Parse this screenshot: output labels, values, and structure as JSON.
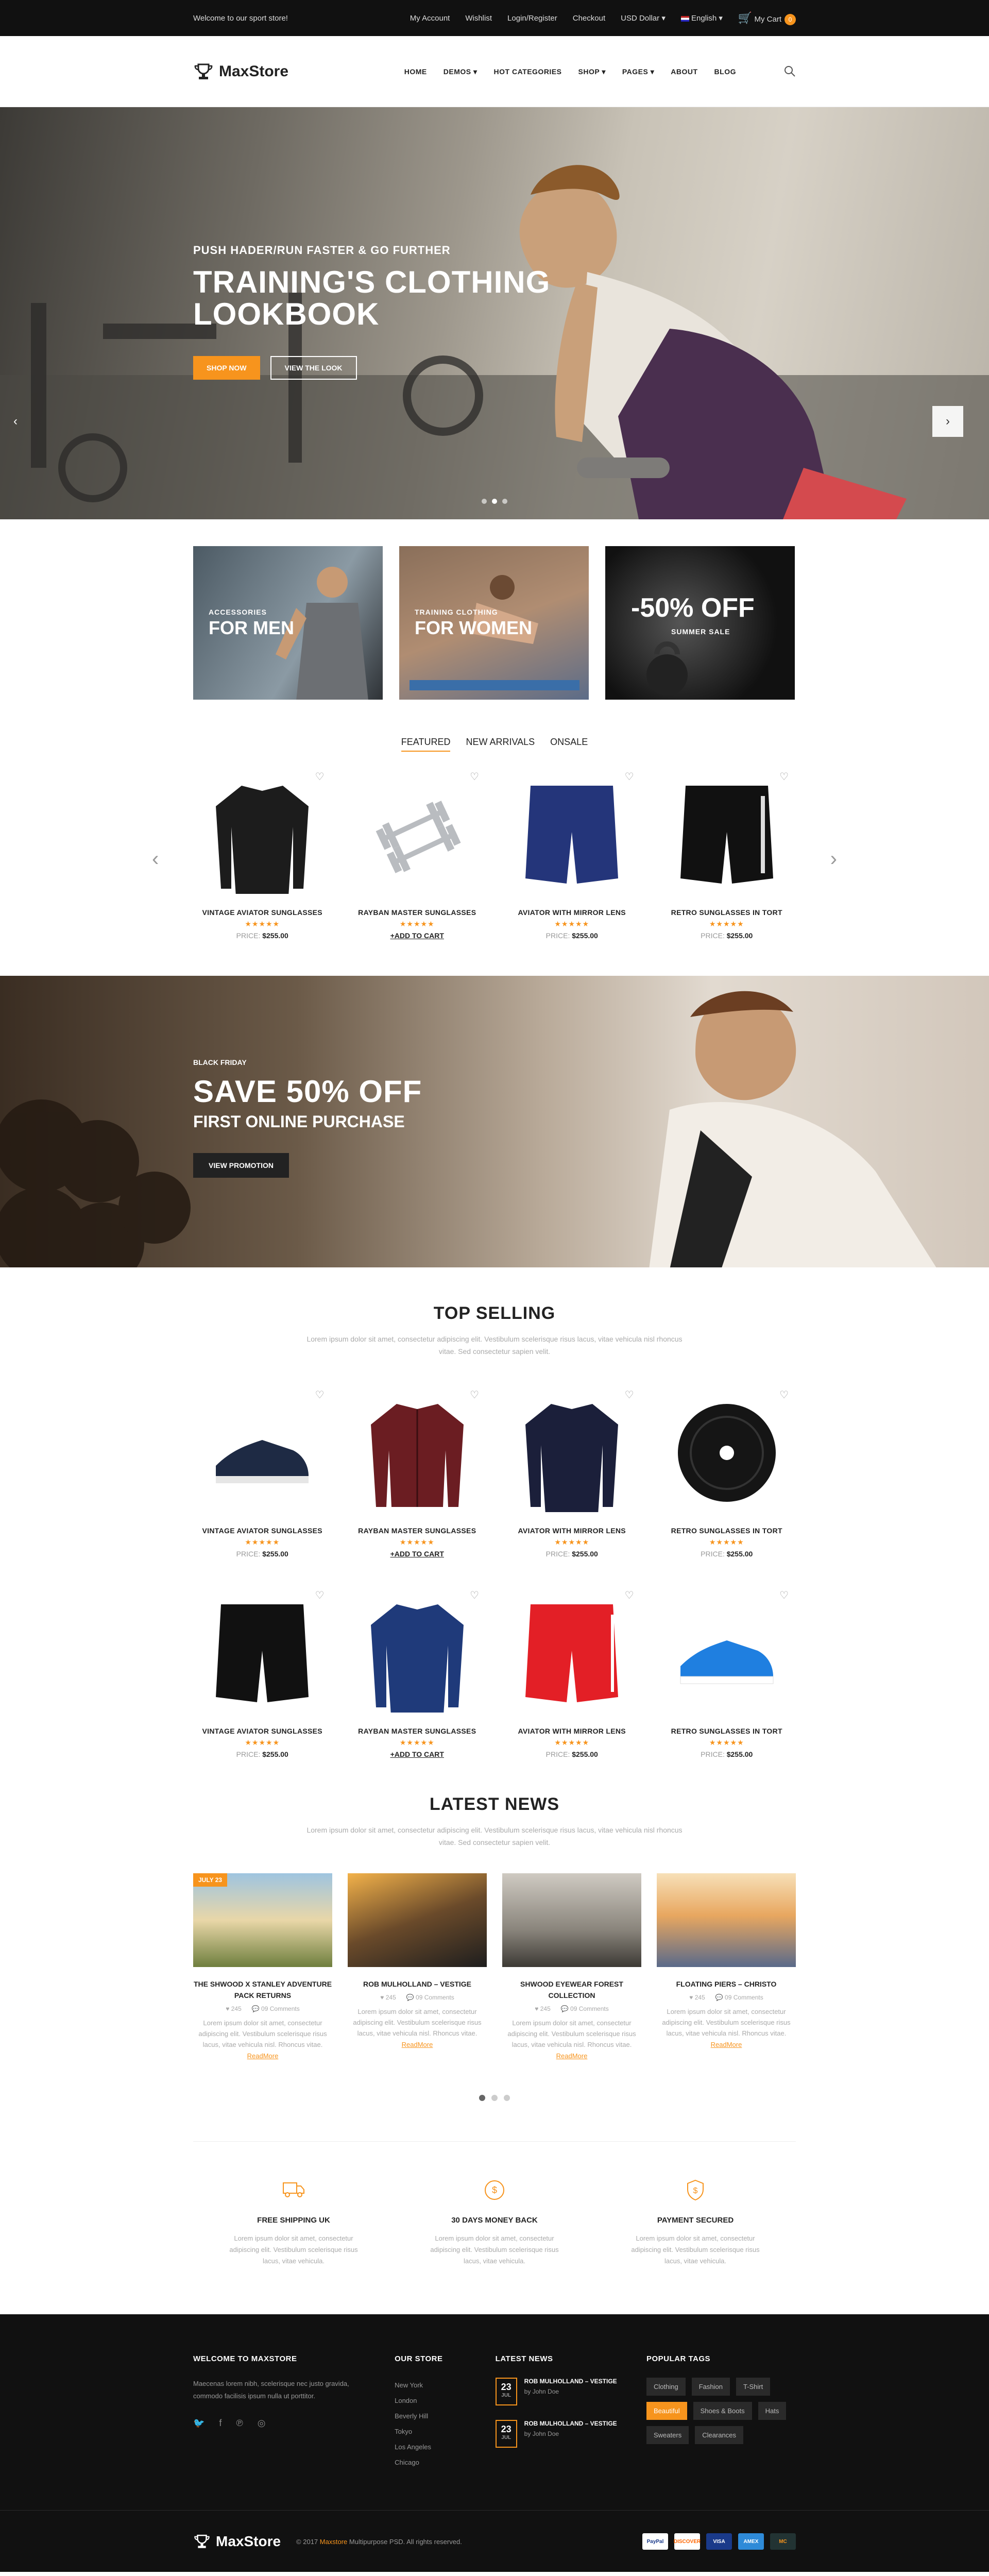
{
  "topbar": {
    "welcome": "Welcome to our sport store!",
    "links": [
      "My Account",
      "Wishlist",
      "Login/Register",
      "Checkout"
    ],
    "currency": "USD Dollar",
    "language": "English",
    "cart_label": "My Cart",
    "cart_count": "0"
  },
  "header": {
    "logo": "MaxStore",
    "nav": [
      "HOME",
      "DEMOS",
      "HOT CATEGORIES",
      "SHOP",
      "PAGES",
      "ABOUT",
      "BLOG"
    ]
  },
  "hero": {
    "subtitle": "PUSH HADER/RUN FASTER & GO FURTHER",
    "title_line1": "TRAINING'S CLOTHING",
    "title_line2": "LOOKBOOK",
    "btn_shop": "SHOP NOW",
    "btn_look": "VIEW THE LOOK"
  },
  "banners": [
    {
      "small": "ACCESSORIES",
      "big": "FOR MEN"
    },
    {
      "small": "TRAINING CLOTHING",
      "big": "FOR WOMEN"
    },
    {
      "small": "SUMMER SALE",
      "big": "-50% OFF"
    }
  ],
  "tabs": [
    "FEATURED",
    "NEW ARRIVALS",
    "ONSALE"
  ],
  "featured": [
    {
      "name": "VINTAGE AVIATOR SUNGLASSES",
      "stars": "★★★★★",
      "price_label": "PRICE:",
      "price": "$255.00"
    },
    {
      "name": "RAYBAN MASTER SUNGLASSES",
      "stars": "★★★★★",
      "add": "+ADD TO CART"
    },
    {
      "name": "AVIATOR WITH MIRROR LENS",
      "stars": "★★★★★",
      "price_label": "PRICE:",
      "price": "$255.00"
    },
    {
      "name": "RETRO SUNGLASSES IN TORT",
      "stars": "★★★★★",
      "price_label": "PRICE:",
      "price": "$255.00"
    }
  ],
  "promo": {
    "tag": "BLACK FRIDAY",
    "headline": "SAVE 50% OFF",
    "subline": "FIRST ONLINE PURCHASE",
    "button": "VIEW PROMOTION"
  },
  "top_selling": {
    "title": "TOP SELLING",
    "desc": "Lorem ipsum dolor sit amet, consectetur adipiscing elit. Vestibulum scelerisque risus lacus, vitae vehicula nisl rhoncus vitae. Sed consectetur sapien velit.",
    "row1": [
      {
        "name": "VINTAGE AVIATOR SUNGLASSES",
        "stars": "★★★★★",
        "price_label": "PRICE:",
        "price": "$255.00"
      },
      {
        "name": "RAYBAN MASTER SUNGLASSES",
        "stars": "★★★★★",
        "add": "+ADD TO CART"
      },
      {
        "name": "AVIATOR WITH MIRROR LENS",
        "stars": "★★★★★",
        "price_label": "PRICE:",
        "price": "$255.00"
      },
      {
        "name": "RETRO SUNGLASSES IN TORT",
        "stars": "★★★★★",
        "price_label": "PRICE:",
        "price": "$255.00"
      }
    ],
    "row2": [
      {
        "name": "VINTAGE AVIATOR SUNGLASSES",
        "stars": "★★★★★",
        "price_label": "PRICE:",
        "price": "$255.00"
      },
      {
        "name": "RAYBAN MASTER SUNGLASSES",
        "stars": "★★★★★",
        "add": "+ADD TO CART"
      },
      {
        "name": "AVIATOR WITH MIRROR LENS",
        "stars": "★★★★★",
        "price_label": "PRICE:",
        "price": "$255.00"
      },
      {
        "name": "RETRO SUNGLASSES IN TORT",
        "stars": "★★★★★",
        "price_label": "PRICE:",
        "price": "$255.00"
      }
    ]
  },
  "news": {
    "title": "LATEST NEWS",
    "desc": "Lorem ipsum dolor sit amet, consectetur adipiscing elit. Vestibulum scelerisque risus lacus, vitae vehicula nisl rhoncus vitae. Sed consectetur sapien velit.",
    "date_badge": "JULY 23",
    "items": [
      {
        "title": "THE SHWOOD X STANLEY ADVENTURE PACK RETURNS",
        "likes": "245",
        "comments": "09 Comments",
        "text": "Lorem ipsum dolor sit amet, consectetur adipiscing elit. Vestibulum scelerisque risus lacus, vitae vehicula nisl. Rhoncus vitae.",
        "more": "ReadMore"
      },
      {
        "title": "ROB MULHOLLAND – VESTIGE",
        "likes": "245",
        "comments": "09 Comments",
        "text": "Lorem ipsum dolor sit amet, consectetur adipiscing elit. Vestibulum scelerisque risus lacus, vitae vehicula nisl. Rhoncus vitae.",
        "more": "ReadMore"
      },
      {
        "title": "SHWOOD EYEWEAR FOREST COLLECTION",
        "likes": "245",
        "comments": "09 Comments",
        "text": "Lorem ipsum dolor sit amet, consectetur adipiscing elit. Vestibulum scelerisque risus lacus, vitae vehicula nisl. Rhoncus vitae.",
        "more": "ReadMore"
      },
      {
        "title": "FLOATING PIERS – CHRISTO",
        "likes": "245",
        "comments": "09 Comments",
        "text": "Lorem ipsum dolor sit amet, consectetur adipiscing elit. Vestibulum scelerisque risus lacus, vitae vehicula nisl. Rhoncus vitae.",
        "more": "ReadMore"
      }
    ]
  },
  "features": [
    {
      "title": "FREE SHIPPING UK",
      "text": "Lorem ipsum dolor sit amet, consectetur adipiscing elit. Vestibulum scelerisque risus lacus, vitae vehicula."
    },
    {
      "title": "30 DAYS MONEY BACK",
      "text": "Lorem ipsum dolor sit amet, consectetur adipiscing elit. Vestibulum scelerisque risus lacus, vitae vehicula."
    },
    {
      "title": "PAYMENT SECURED",
      "text": "Lorem ipsum dolor sit amet, consectetur adipiscing elit. Vestibulum scelerisque risus lacus, vitae vehicula."
    }
  ],
  "footer": {
    "about_title": "WELCOME TO MAXSTORE",
    "about_text": "Maecenas lorem nibh, scelerisque nec justo gravida, commodo facilisis ipsum nulla ut porttitor.",
    "store_title": "OUR STORE",
    "stores": [
      "New York",
      "London",
      "Beverly Hill",
      "Tokyo",
      "Los Angeles",
      "Chicago"
    ],
    "news_title": "LATEST NEWS",
    "news_items": [
      {
        "day": "23",
        "month": "JUL",
        "title": "ROB MULHOLLAND – VESTIGE",
        "author": "John Doe"
      },
      {
        "day": "23",
        "month": "JUL",
        "title": "ROB MULHOLLAND – VESTIGE",
        "author": "John Doe"
      }
    ],
    "tags_title": "POPULAR TAGS",
    "tags": [
      "Clothing",
      "Fashion",
      "T-Shirt",
      "Beautiful",
      "Shoes & Boots",
      "Hats",
      "Sweaters",
      "Clearances"
    ],
    "logo": "MaxStore",
    "copyright_pre": "© 2017",
    "copyright_brand": "Maxstore",
    "copyright_post": "Multipurpose PSD. All rights reserved.",
    "payments": [
      "PayPal",
      "DISCOVER",
      "VISA",
      "AMEX",
      "MC"
    ]
  },
  "colors": {
    "accent": "#f7941d",
    "dark": "#111111"
  }
}
